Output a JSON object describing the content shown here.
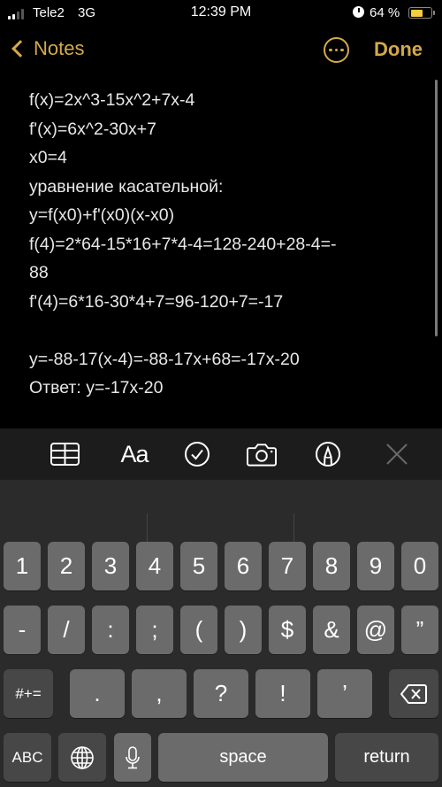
{
  "status_bar": {
    "carrier": "Tele2",
    "network": "3G",
    "time": "12:39 PM",
    "battery_percent_label": "64 %",
    "battery_level": 0.64,
    "alarm_icon": "alarm-clock-icon",
    "signal_bars": 2,
    "signal_max": 4
  },
  "nav": {
    "back_label": "Notes",
    "more_icon": "ellipsis-circle-icon",
    "done_label": "Done",
    "accent_color": "#d4a94a"
  },
  "note": {
    "lines": [
      "f(x)=2x^3-15x^2+7x-4",
      "f'(x)=6x^2-30x+7",
      "x0=4",
      "уравнение касательной:",
      "y=f(x0)+f'(x0)(x-x0)",
      "f(4)=2*64-15*16+7*4-4=128-240+28-4=-",
      "88",
      "f'(4)=6*16-30*4+7=96-120+7=-17",
      "",
      "y=-88-17(x-4)=-88-17x+68=-17x-20",
      "Ответ: y=-17x-20"
    ]
  },
  "toolbar": {
    "items": [
      {
        "name": "table-button",
        "icon": "table-icon"
      },
      {
        "name": "format-button",
        "label": "Aa",
        "icon": "text-format-icon"
      },
      {
        "name": "checklist-button",
        "icon": "checkmark-circle-icon"
      },
      {
        "name": "camera-button",
        "icon": "camera-icon"
      },
      {
        "name": "markup-button",
        "icon": "pen-tip-circle-icon"
      },
      {
        "name": "close-toolbar-button",
        "icon": "close-icon"
      }
    ]
  },
  "keyboard": {
    "row1": [
      "1",
      "2",
      "3",
      "4",
      "5",
      "6",
      "7",
      "8",
      "9",
      "0"
    ],
    "row2": [
      "-",
      "/",
      ":",
      ";",
      "(",
      ")",
      "$",
      "&",
      "@",
      "”"
    ],
    "row3": [
      ".",
      ",",
      "?",
      "!",
      "’"
    ],
    "symbols_key": "#+=",
    "abc_key": "ABC",
    "globe_icon": "globe-icon",
    "mic_icon": "microphone-icon",
    "space_label": "space",
    "return_label": "return",
    "delete_icon": "backspace-icon"
  }
}
